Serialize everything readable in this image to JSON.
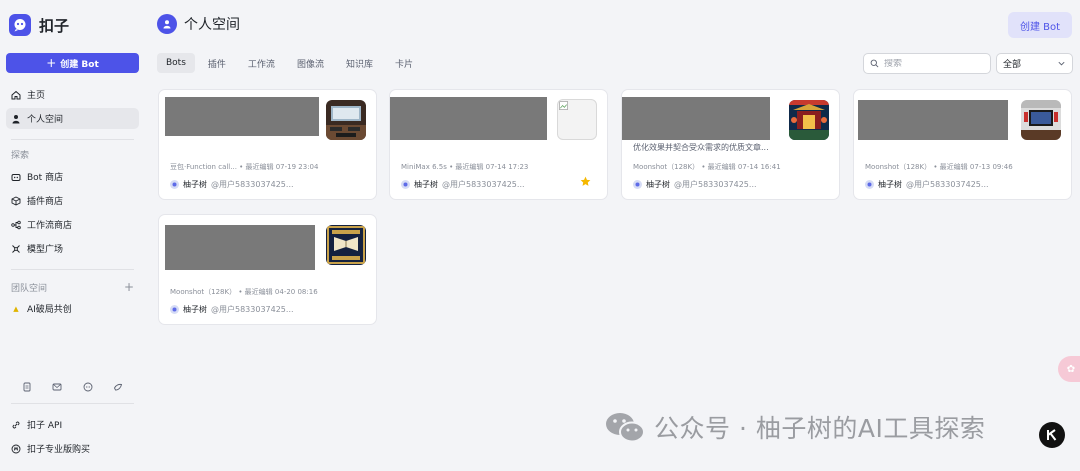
{
  "brand": {
    "name": "扣子"
  },
  "sidebar": {
    "create_bot": "创建 Bot",
    "nav": [
      {
        "label": "主页",
        "icon": "home-icon"
      },
      {
        "label": "个人空间",
        "icon": "person-icon"
      }
    ],
    "explore_label": "探索",
    "explore": [
      {
        "label": "Bot 商店",
        "icon": "bot-icon"
      },
      {
        "label": "插件商店",
        "icon": "cube-icon"
      },
      {
        "label": "工作流商店",
        "icon": "workflow-icon"
      },
      {
        "label": "模型广场",
        "icon": "model-icon"
      }
    ],
    "team_label": "团队空间",
    "team_add": "+",
    "teams": [
      {
        "label": "AI破局共创"
      }
    ],
    "bottom_links": [
      {
        "label": "扣子 API",
        "icon": "link-icon"
      },
      {
        "label": "扣子专业版购买",
        "icon": "coin-icon"
      }
    ]
  },
  "header": {
    "title": "个人空间",
    "create_bot": "创建 Bot"
  },
  "tabs": [
    "Bots",
    "插件",
    "工作流",
    "图像流",
    "知识库",
    "卡片"
  ],
  "search": {
    "placeholder": "搜索"
  },
  "filter": {
    "selected": "全部"
  },
  "cards": [
    {
      "meta": "豆包·Function call...  • 最近编辑 07-19 23:04",
      "author": "柚子树",
      "handle": "@用户5833037425..."
    },
    {
      "meta": "MiniMax 6.5s  • 最近编辑 07-14 17:23",
      "author": "柚子树",
      "handle": "@用户5833037425...",
      "starred": true
    },
    {
      "meta": "Moonshot（128K）  • 最近编辑 07-14 16:41",
      "author": "柚子树",
      "handle": "@用户5833037425...",
      "desc": "优化效果并契合受众需求的优质文章..."
    },
    {
      "meta": "Moonshot（128K）  • 最近编辑 07-13 09:46",
      "author": "柚子树",
      "handle": "@用户5833037425..."
    },
    {
      "meta": "Moonshot（128K）  • 最近编辑 04-20 08:16",
      "author": "柚子树",
      "handle": "@用户5833037425..."
    }
  ],
  "watermark": {
    "text": "公众号 · 柚子树的AI工具探索"
  },
  "colors": {
    "accent": "#4d53e8",
    "accent_light": "#e1e2fa",
    "star": "#f5b800"
  }
}
